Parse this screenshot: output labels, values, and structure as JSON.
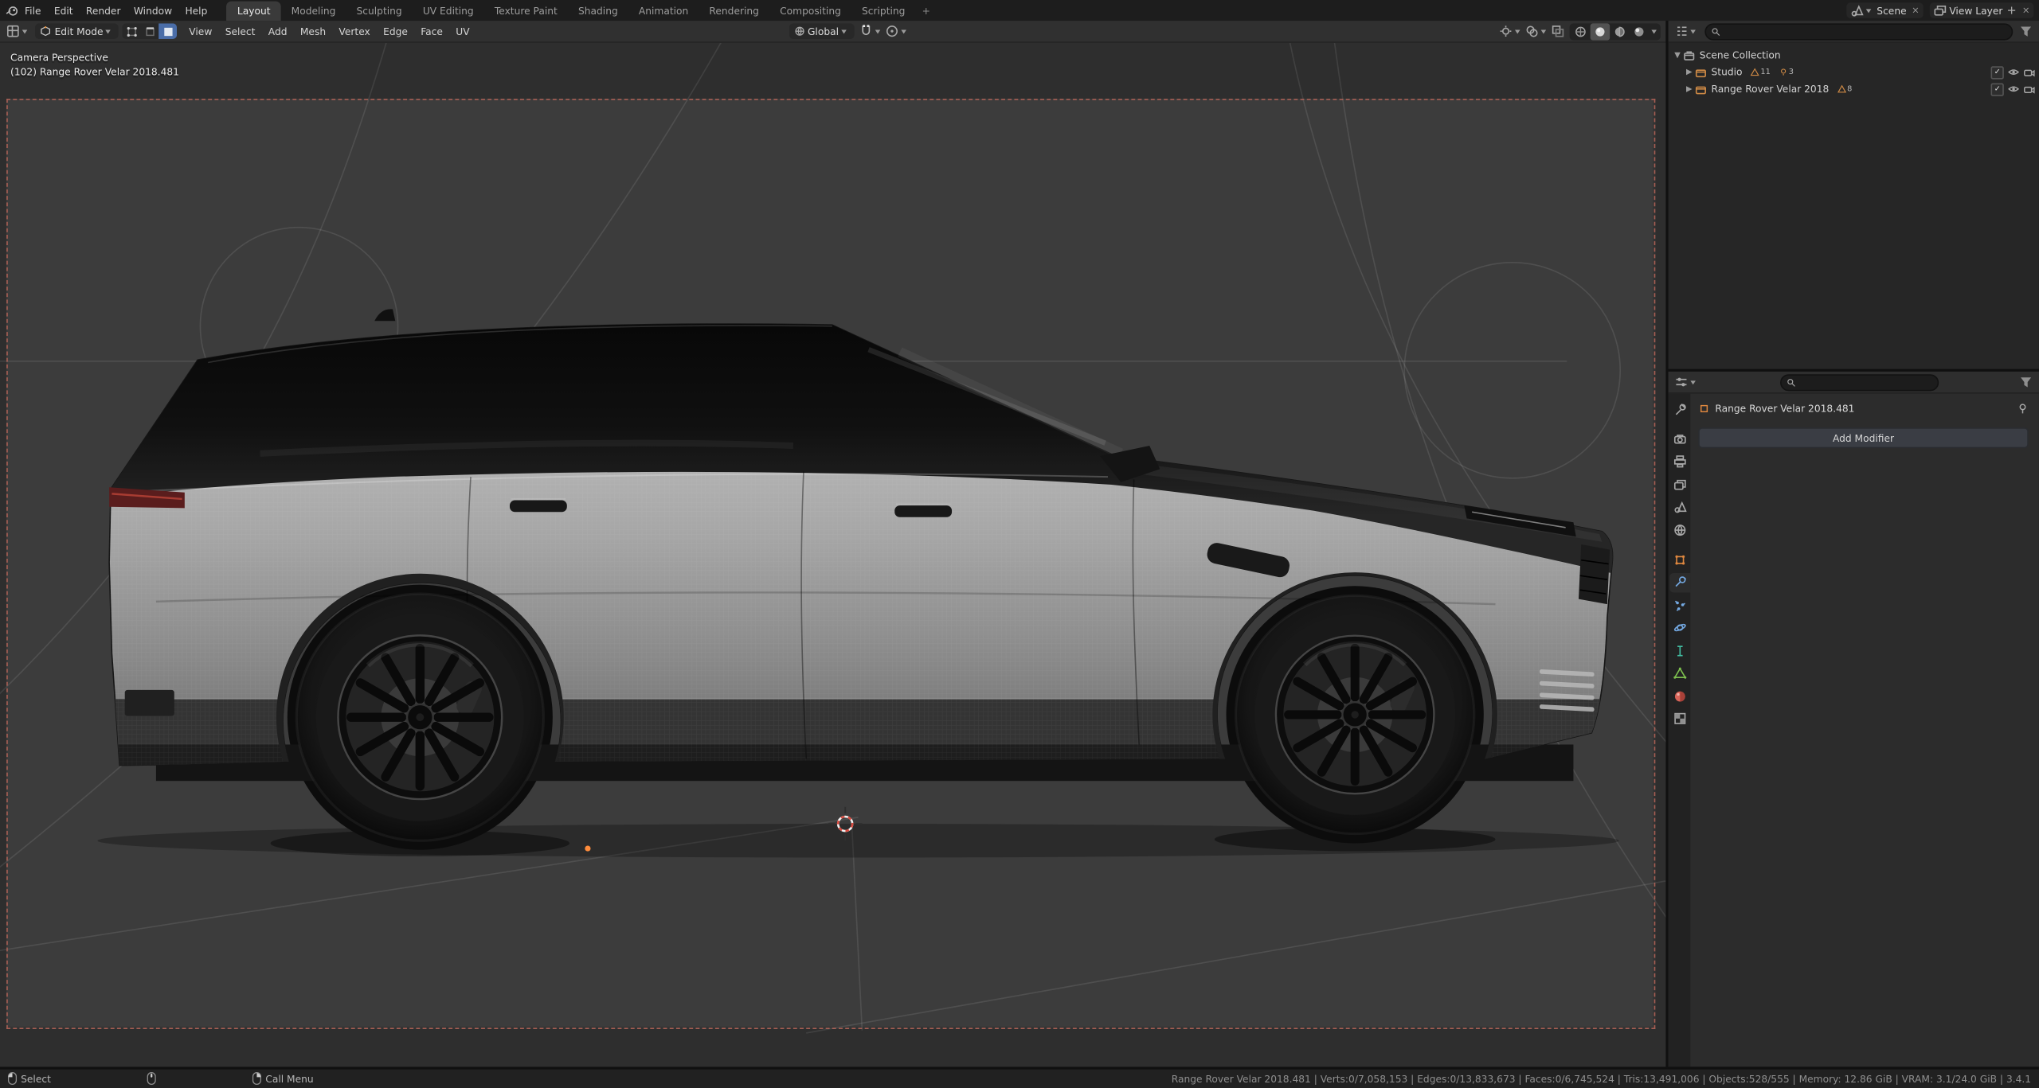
{
  "topbar": {
    "menus": [
      "File",
      "Edit",
      "Render",
      "Window",
      "Help"
    ],
    "tabs": [
      "Layout",
      "Modeling",
      "Sculpting",
      "UV Editing",
      "Texture Paint",
      "Shading",
      "Animation",
      "Rendering",
      "Compositing",
      "Scripting"
    ],
    "add_tab": "+",
    "scene_label": "Scene",
    "view_layer_label": "View Layer"
  },
  "viewport_header": {
    "mode": "Edit Mode",
    "menus": [
      "View",
      "Select",
      "Add",
      "Mesh",
      "Vertex",
      "Edge",
      "Face",
      "UV"
    ],
    "orientation": "Global"
  },
  "viewport": {
    "view_label": "Camera Perspective",
    "object_label": "(102) Range Rover Velar 2018.481"
  },
  "outliner": {
    "scene_collection": "Scene Collection",
    "rows": [
      {
        "name": "Studio",
        "count1": "11",
        "count2": "3"
      },
      {
        "name": "Range Rover Velar 2018",
        "count1": "8"
      }
    ]
  },
  "properties": {
    "breadcrumb": "Range Rover Velar 2018.481",
    "add_modifier": "Add Modifier"
  },
  "statusbar": {
    "select": "Select",
    "call_menu": "Call Menu",
    "stats": "Range Rover Velar 2018.481 | Verts:0/7,058,153 | Edges:0/13,833,673 | Faces:0/6,745,524 | Tris:13,491,006 | Objects:528/555 | Memory: 12.86 GiB | VRAM: 3.1/24.0 GiB | 3.4.1"
  },
  "colors": {
    "accent": "#4772b3",
    "object_orange": "#e0883f",
    "viewport_bg": "#3c3c3c"
  }
}
